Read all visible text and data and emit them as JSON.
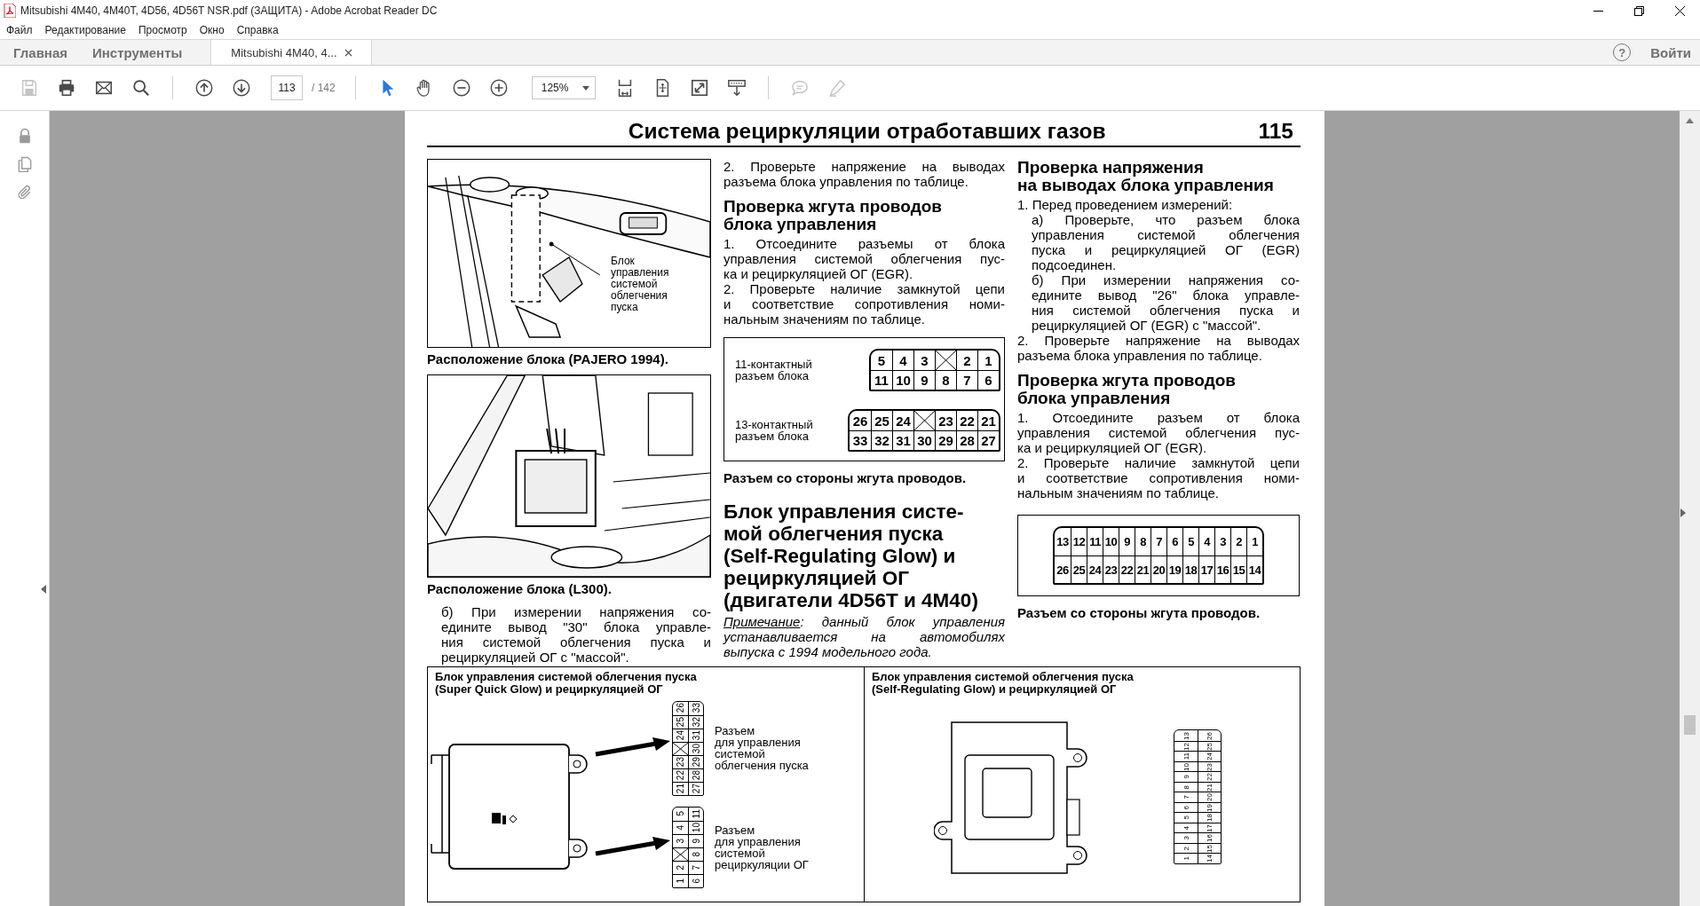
{
  "window": {
    "title": "Mitsubishi 4M40, 4M40T, 4D56, 4D56T NSR.pdf (ЗАЩИТА) - Adobe Acrobat Reader DC"
  },
  "menu": [
    "Файл",
    "Редактирование",
    "Просмотр",
    "Окно",
    "Справка"
  ],
  "tabs": [
    {
      "label": "Главная",
      "kind": "nav",
      "selected": false
    },
    {
      "label": "Инструменты",
      "kind": "nav",
      "selected": false
    },
    {
      "label": "Mitsubishi 4M40, 4...",
      "kind": "document",
      "selected": true
    }
  ],
  "help": "?",
  "sign_in": "Войти",
  "toolbar": {
    "file_buttons": [
      {
        "kind": "save",
        "disabled": true
      },
      {
        "kind": "print",
        "disabled": false
      },
      {
        "kind": "mail",
        "disabled": false
      },
      {
        "kind": "search",
        "disabled": false
      }
    ],
    "nav_buttons": [
      {
        "kind": "prev",
        "disabled": false
      },
      {
        "kind": "next",
        "disabled": false
      }
    ],
    "page": "113",
    "page_total": "/ 142",
    "tools": [
      {
        "kind": "select",
        "selected": true
      },
      {
        "kind": "hand",
        "selected": false
      }
    ],
    "zoom_buttons": [
      {
        "kind": "zoom-out",
        "disabled": false
      },
      {
        "kind": "zoom-in",
        "disabled": false
      }
    ],
    "zoom": "125%",
    "view_buttons": [
      {
        "kind": "fit",
        "disabled": false
      },
      {
        "kind": "rotate",
        "disabled": false
      },
      {
        "kind": "fullscreen",
        "disabled": false
      },
      {
        "kind": "scroll",
        "disabled": false
      }
    ],
    "comment_buttons": [
      {
        "kind": "comment",
        "disabled": true
      },
      {
        "kind": "draw",
        "disabled": true
      }
    ]
  },
  "sidebar": [
    {
      "kind": "lock"
    },
    {
      "kind": "pages"
    },
    {
      "kind": "attachment"
    }
  ],
  "document": {
    "header": {
      "title": "Система рециркуляции отработавших газов",
      "page_number": "115"
    },
    "columns": [
      [
        {
          "kind": "figure",
          "label": "Блок\nуправления\nсистемой\nоблегчения\nпуска"
        },
        {
          "kind": "caption",
          "text": "Расположение блока (PAJERO 1994)."
        },
        {
          "kind": "figure"
        },
        {
          "kind": "caption",
          "text": "Расположение блока (L300)."
        },
        {
          "kind": "subpara",
          "text": "б) При измерении напряжения со-\nедините вывод \"30\" блока управле-\nния системой облегчения пуска и\nрециркуляцией ОГ с \"массой\"."
        }
      ],
      [
        {
          "kind": "para",
          "text": "2. Проверьте напряжение на выводах\nразъема блока управления по таблице."
        },
        {
          "kind": "heading",
          "text": "Проверка жгута проводов\nблока управления"
        },
        {
          "kind": "para",
          "text": "1. Отсоедините разъемы от блока\nуправления системой облегчения пус-\nка и рециркуляцией ОГ (EGR)."
        },
        {
          "kind": "para",
          "text": "2. Проверьте наличие замкнутой цепи\nи соответствие сопротивления номи-\nнальным значениям по таблице."
        },
        {
          "kind": "connector-table",
          "items": [
            {
              "label": "11-контактный\nразъем блока",
              "rows": [
                [
                  "5",
                  "4",
                  "3",
                  null,
                  "2",
                  "1"
                ],
                [
                  "11",
                  "10",
                  "9",
                  "8",
                  "7",
                  "6"
                ]
              ]
            },
            {
              "label": "13-контактный\nразъем блока",
              "rows": [
                [
                  "26",
                  "25",
                  "24",
                  null,
                  "23",
                  "22",
                  "21"
                ],
                [
                  "33",
                  "32",
                  "31",
                  "30",
                  "29",
                  "28",
                  "27"
                ]
              ]
            }
          ]
        },
        {
          "kind": "caption",
          "text": "Разъем со стороны жгута проводов."
        },
        {
          "kind": "title",
          "text": "Блок управления систе-\nмой облегчения пуска\n(Self-Regulating Glow) и\nрециркуляцией ОГ\n(двигатели 4D56T и 4M40)"
        },
        {
          "kind": "note",
          "label": "Примечание",
          "text": ": данный блок управления\nустанавливается на автомобилях\nвыпуска с 1994 модельного года."
        }
      ],
      [
        {
          "kind": "heading",
          "text": "Проверка напряжения\nна выводах блока управления"
        },
        {
          "kind": "para",
          "text": "1. Перед проведением измерений:"
        },
        {
          "kind": "subpara",
          "text": "а) Проверьте, что разъем блока\nуправления системой облегчения\nпуска и рециркуляцией ОГ (EGR)\nподсоединен."
        },
        {
          "kind": "subpara",
          "text": "б) При измерении напряжения со-\nедините вывод \"26\" блока управле-\nния системой облегчения пуска и\nрециркуляцией ОГ (EGR) с \"массой\"."
        },
        {
          "kind": "para",
          "text": "2. Проверьте напряжение на выводах\nразъема блока управления по таблице."
        },
        {
          "kind": "heading",
          "text": "Проверка жгута проводов\nблока управления"
        },
        {
          "kind": "para",
          "text": "1. Отсоедините разъем от блока\nуправления системой облегчения пус-\nка и рециркуляцией ОГ (EGR)."
        },
        {
          "kind": "para",
          "text": "2. Проверьте наличие замкнутой цепи\nи соответствие сопротивления номи-\nнальным значениям по таблице."
        },
        {
          "kind": "connector-table",
          "items": [
            {
              "rows": [
                [
                  "13",
                  "12",
                  "11",
                  "10",
                  "9",
                  "8",
                  "7",
                  "6",
                  "5",
                  "4",
                  "3",
                  "2",
                  "1"
                ],
                [
                  "26",
                  "25",
                  "24",
                  "23",
                  "22",
                  "21",
                  "20",
                  "19",
                  "18",
                  "17",
                  "16",
                  "15",
                  "14"
                ]
              ]
            }
          ]
        },
        {
          "kind": "caption",
          "text": "Разъем со стороны жгута проводов."
        }
      ]
    ],
    "panels": [
      {
        "title": "Блок управления системой облегчения пуска\n(Super Quick Glow) и рециркуляцией ОГ",
        "connectors": [
          {
            "label": "Разъем\nдля управления\nсистемой\nоблегчения пуска",
            "rows": [
              [
                "26",
                "33"
              ],
              [
                "25",
                "32"
              ],
              [
                "24",
                "31"
              ],
              [
                null,
                "30"
              ],
              [
                "23",
                "29"
              ],
              [
                "22",
                "28"
              ],
              [
                "21",
                "27"
              ]
            ]
          },
          {
            "label": "Разъем\nдля управления\nсистемой\nрециркуляции ОГ",
            "rows": [
              [
                "5",
                "11"
              ],
              [
                "4",
                "10"
              ],
              [
                "3",
                "9"
              ],
              [
                null,
                "8"
              ],
              [
                "2",
                "7"
              ],
              [
                "1",
                "6"
              ]
            ]
          }
        ]
      },
      {
        "title": "Блок управления системой облегчения пуска\n(Self-Regulating Glow) и рециркуляцией ОГ",
        "connectors": [
          {
            "rows": [
              [
                "13",
                "26"
              ],
              [
                "12",
                "25"
              ],
              [
                "11",
                "24"
              ],
              [
                "10",
                "23"
              ],
              [
                "9",
                "22"
              ],
              [
                "8",
                "21"
              ],
              [
                "7",
                "20"
              ],
              [
                "6",
                "19"
              ],
              [
                "5",
                "18"
              ],
              [
                "4",
                "17"
              ],
              [
                "3",
                "16"
              ],
              [
                "2",
                "15"
              ],
              [
                "1",
                "14"
              ]
            ]
          }
        ]
      }
    ]
  }
}
